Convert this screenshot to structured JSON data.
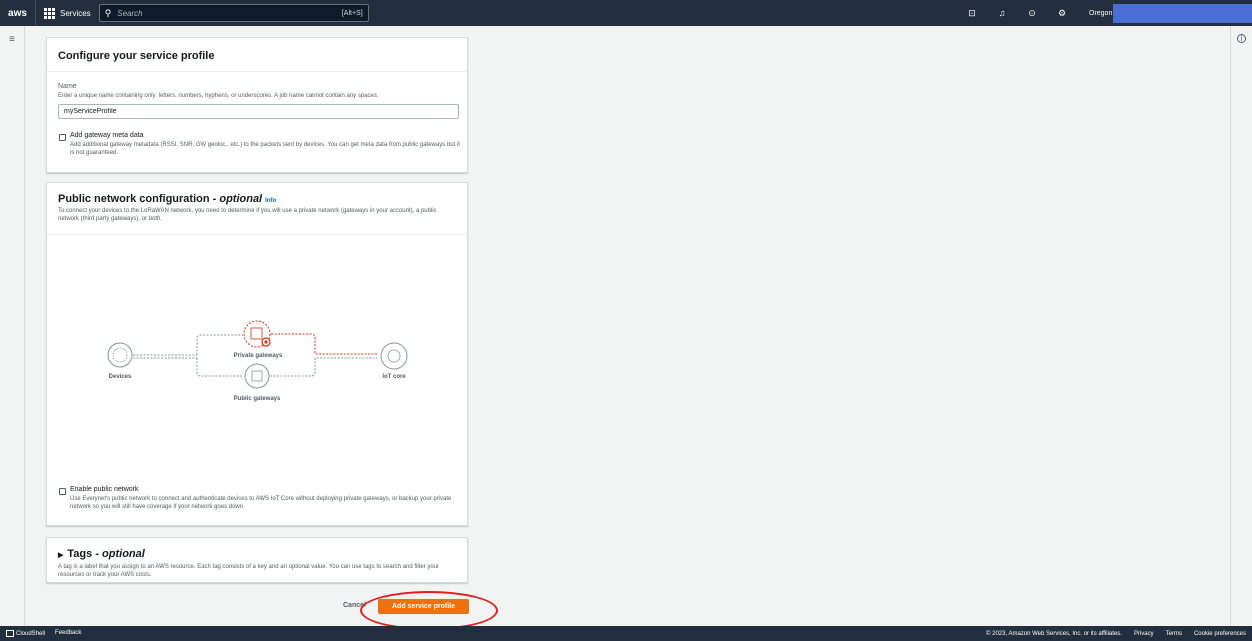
{
  "topnav": {
    "logo": "aws",
    "services_label": "Services",
    "search_placeholder": "Search",
    "search_shortcut": "[Alt+S]",
    "region": "Oregon ▾"
  },
  "profile": {
    "title": "Configure your service profile",
    "name_label": "Name",
    "name_desc": "Enter a unique name containing only: letters, numbers, hyphens, or underscores. A job name cannot contain any spaces.",
    "name_value": "myServiceProfile",
    "gateway_label": "Add gateway meta data",
    "gateway_desc": "Add additional gateway metadata (RSSI, SNR, GW geoloc., etc.) to the packets sent by devices. You can get meta data from public gateways but it is not guaranteed."
  },
  "public_network": {
    "title": "Public network configuration - ",
    "title_optional": "optional",
    "info": "Info",
    "desc": "To connect your devices to the LoRaWAN network, you need to determine if you will use a private network (gateways in your account), a public network (third party gateways), or both.",
    "diagram": {
      "devices": "Devices",
      "private": "Private gateways",
      "public": "Public gateways",
      "iot": "IoT core"
    },
    "enable_label": "Enable public network",
    "enable_desc": "Use Everynet's public network to connect and authenticate devices to AWS IoT Core without deploying private gateways, or backup your private network so you will still have coverage if your network goes down."
  },
  "tags": {
    "title": "Tags - ",
    "title_optional": "optional",
    "desc": "A tag is a label that you assign to an AWS resource. Each tag consists of a key and an optional value. You can use tags to search and filter your resources or track your AWS costs."
  },
  "actions": {
    "cancel": "Cancel",
    "submit": "Add service profile"
  },
  "footer": {
    "cloudshell": "CloudShell",
    "feedback": "Feedback",
    "copyright": "© 2023, Amazon Web Services, Inc. or its affiliates.",
    "privacy": "Privacy",
    "terms": "Terms",
    "cookies": "Cookie preferences"
  },
  "colors": {
    "nav": "#232f3e",
    "primary": "#ec7211",
    "annotation": "#e02020",
    "private_path": "#d13212"
  }
}
